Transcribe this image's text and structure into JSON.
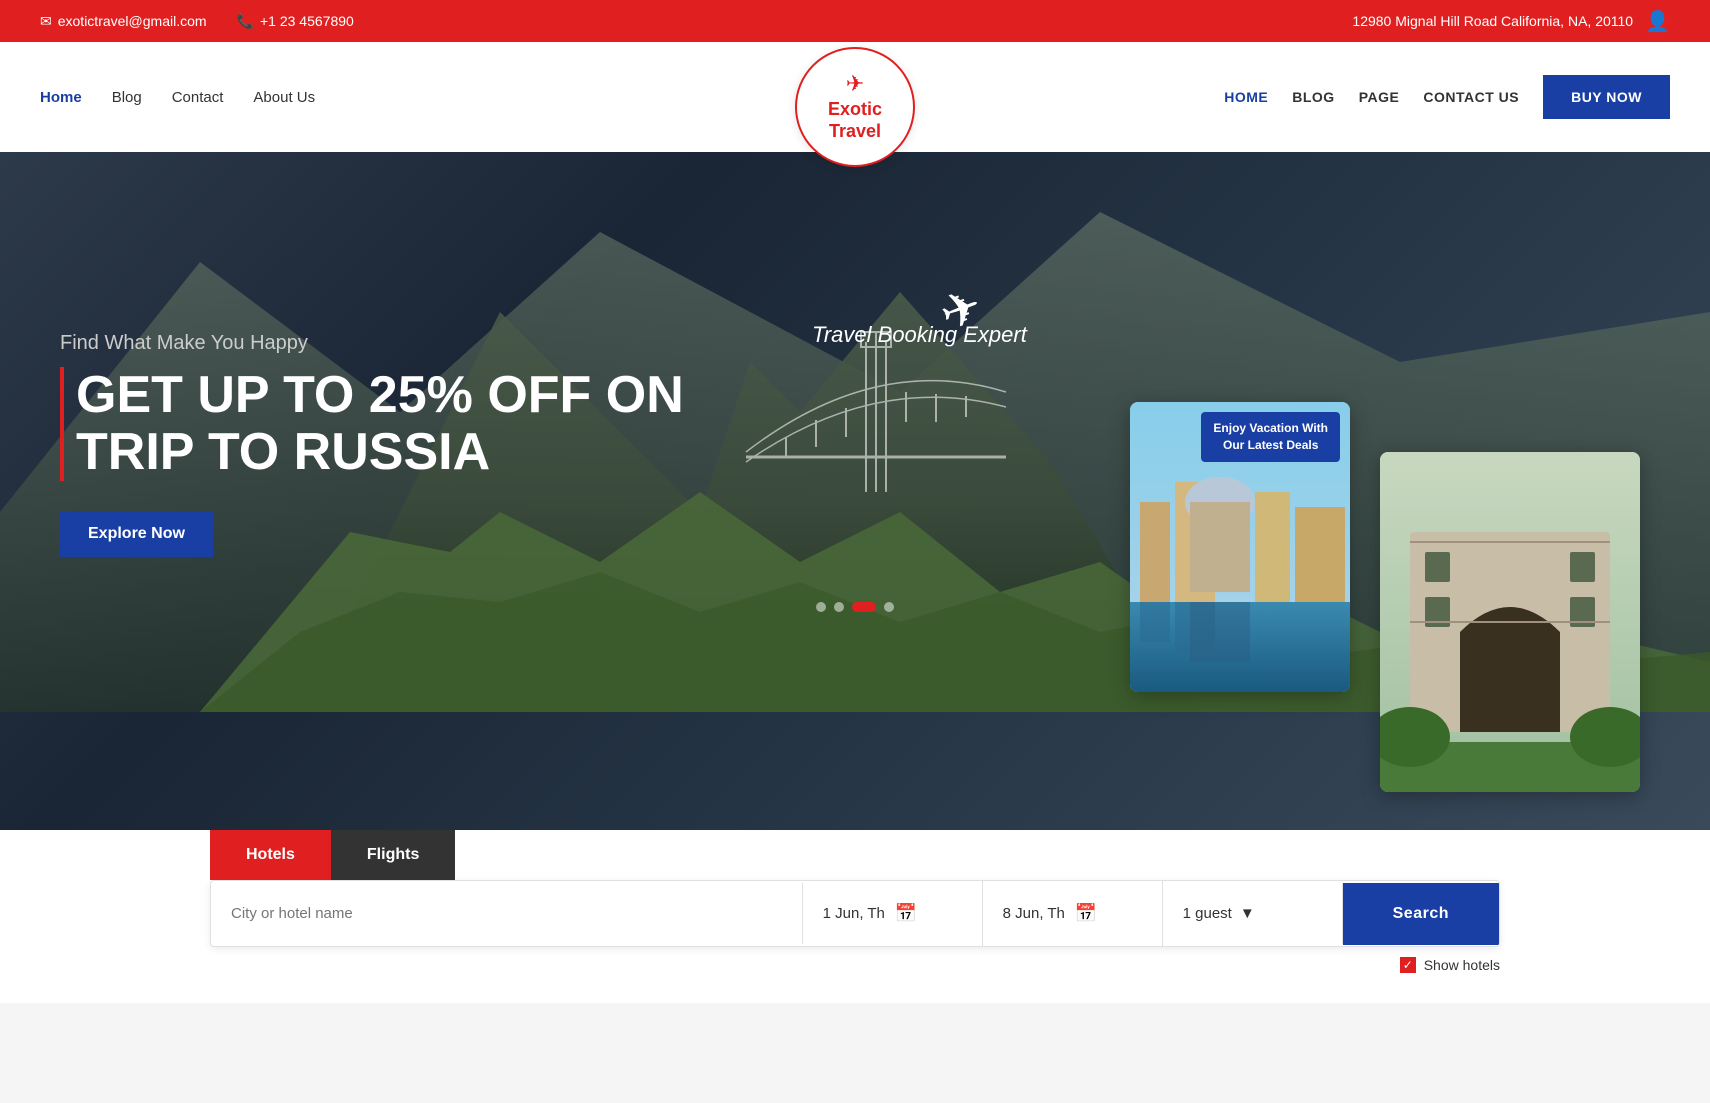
{
  "topbar": {
    "email": "exotictravel@gmail.com",
    "phone": "+1 23 4567890",
    "address": "12980 Mignal Hill Road California, NA, 20110"
  },
  "header": {
    "left_nav": [
      {
        "label": "Home",
        "active": true
      },
      {
        "label": "Blog",
        "active": false
      },
      {
        "label": "Contact",
        "active": false
      },
      {
        "label": "About Us",
        "active": false
      }
    ],
    "logo": {
      "brand": "Exotic\nTravel"
    },
    "right_nav": [
      {
        "label": "HOME",
        "active": true
      },
      {
        "label": "BLOG",
        "active": false
      },
      {
        "label": "PAGE",
        "active": false
      },
      {
        "label": "CONTACT US",
        "active": false
      }
    ],
    "buy_now": "BUY NOW"
  },
  "hero": {
    "center_text": "Travel Booking Expert",
    "subtitle": "Find What Make You Happy",
    "title_line1": "GET UP TO 25% OFF ON",
    "title_line2": "TRIP TO RUSSIA",
    "cta": "Explore Now",
    "card1_badge": "Enjoy Vacation With\nOur Latest Deals",
    "dots": [
      1,
      2,
      3,
      4
    ]
  },
  "search": {
    "tabs": [
      {
        "label": "Hotels",
        "active": true
      },
      {
        "label": "Flights",
        "active": false
      }
    ],
    "placeholder": "City or hotel name",
    "checkin": "1 Jun, Th",
    "checkout": "8 Jun, Th",
    "guests": "1 guest",
    "search_btn": "Search",
    "show_hotels": "Show hotels"
  }
}
